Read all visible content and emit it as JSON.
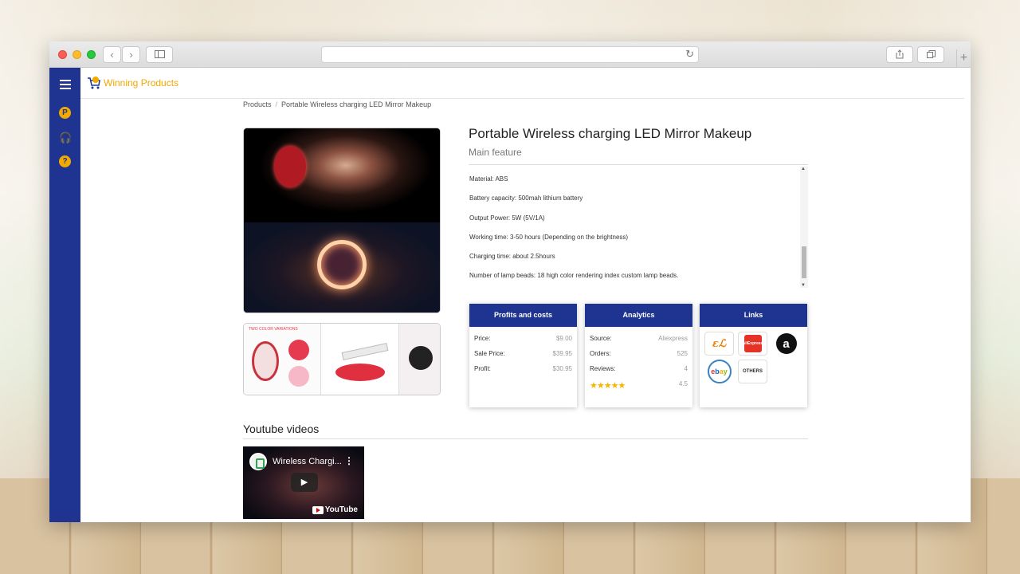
{
  "browser": {
    "back_icon": "chevron-left-icon",
    "forward_icon": "chevron-right-icon",
    "sidebar_icon": "sidebar-toggle-icon",
    "reload_icon": "reload-icon",
    "share_icon": "share-icon",
    "tabs_icon": "tabs-icon",
    "new_tab": "+"
  },
  "sidebar": {
    "icons": [
      "menu-icon",
      "p-badge-icon",
      "headphones-icon",
      "help-icon"
    ],
    "p_badge": "P",
    "help_badge": "?",
    "headphones_glyph": "🎧"
  },
  "brand": {
    "name": "Winning Products",
    "color": "#f2a900"
  },
  "breadcrumb": {
    "root": "Products",
    "current": "Portable Wireless charging LED Mirror Makeup"
  },
  "product": {
    "title": "Portable Wireless charging LED Mirror Makeup",
    "subtitle": "Main feature",
    "features": [
      "Material: ABS",
      "Battery capacity: 500mah lithium battery",
      "Output Power: 5W (5V/1A)",
      "Working time: 3-50 hours (Depending on the brightness)",
      "Charging time: about 2.5hours",
      "Number of lamp beads: 18 high color rendering index custom lamp beads."
    ],
    "thumb_caption": "TWO COLOR VARIATIONS"
  },
  "profits": {
    "title": "Profits and costs",
    "rows": [
      {
        "label": "Price:",
        "value": "$9.00"
      },
      {
        "label": "Sale Price:",
        "value": "$39.95"
      },
      {
        "label": "Profit:",
        "value": "$30.95"
      }
    ]
  },
  "analytics": {
    "title": "Analytics",
    "rows": [
      {
        "label": "Source:",
        "value": "Aliexpress"
      },
      {
        "label": "Orders:",
        "value": "525"
      },
      {
        "label": "Reviews:",
        "value": "4"
      }
    ],
    "rating": 4.5,
    "rating_text": "4.5",
    "stars": "★★★★★"
  },
  "links": {
    "title": "Links",
    "items": [
      {
        "name": "alibaba",
        "text": "ɛℒ"
      },
      {
        "name": "aliexpress",
        "text": "AliExpress"
      },
      {
        "name": "amazon",
        "text": "a"
      },
      {
        "name": "ebay",
        "text": "ebay"
      },
      {
        "name": "others",
        "text": "OTHERS"
      }
    ]
  },
  "youtube": {
    "section_title": "Youtube videos",
    "video_title": "Wireless Chargi...",
    "more_glyph": "⋮",
    "play_glyph": "▶",
    "logo_text": "YouTube"
  },
  "colors": {
    "sidebar": "#1f3491",
    "accent": "#f2a900",
    "card_header": "#1f3491"
  }
}
